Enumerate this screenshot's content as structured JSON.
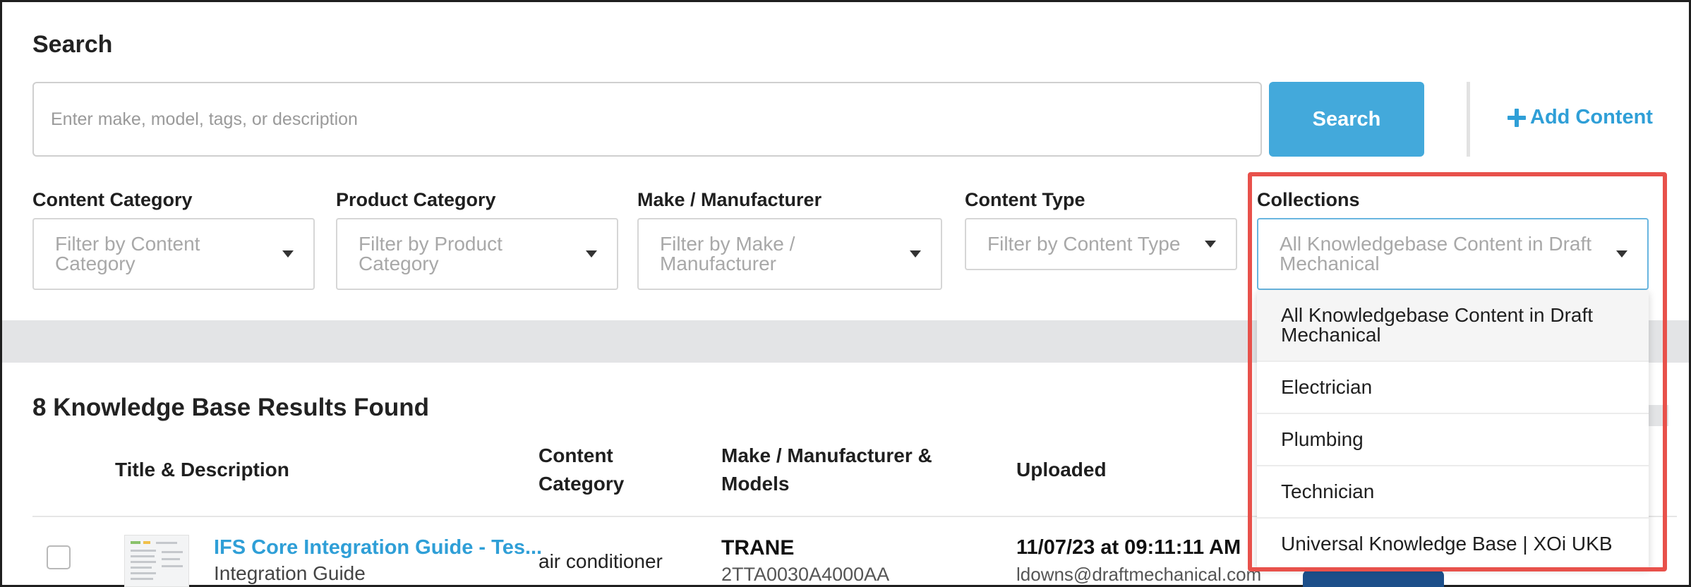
{
  "search": {
    "title": "Search",
    "placeholder": "Enter make, model, tags, or description",
    "button_label": "Search",
    "add_content_label": "Add Content"
  },
  "filters": [
    {
      "label": "Content Category",
      "placeholder": "Filter by Content Category",
      "line1": "Filter by Content",
      "line2": "Category"
    },
    {
      "label": "Product Category",
      "placeholder": "Filter by Product Category",
      "line1": "Filter by Product",
      "line2": "Category"
    },
    {
      "label": "Make / Manufacturer",
      "placeholder": "Filter by Make / Manufacturer",
      "line1": "Filter by Make /",
      "line2": "Manufacturer"
    },
    {
      "label": "Content Type",
      "placeholder": "Filter by Content Type",
      "line1": "Filter by Content Type",
      "line2": ""
    }
  ],
  "collections": {
    "label": "Collections",
    "selected_line1": "All Knowledgebase Content in Draft",
    "selected_line2": "Mechanical",
    "options": [
      {
        "line1": "All Knowledgebase Content in Draft",
        "line2": "Mechanical"
      },
      {
        "line1": "Electrician",
        "line2": ""
      },
      {
        "line1": "Plumbing",
        "line2": ""
      },
      {
        "line1": "Technician",
        "line2": ""
      },
      {
        "line1": "Universal Knowledge Base | XOi UKB",
        "line2": ""
      }
    ]
  },
  "results": {
    "count_title": "8 Knowledge Base Results Found",
    "columns": {
      "title": "Title & Description",
      "category_line1": "Content",
      "category_line2": "Category",
      "make_line1": "Make / Manufacturer &",
      "make_line2": "Models",
      "uploaded": "Uploaded"
    },
    "rows": [
      {
        "title": "IFS Core Integration Guide - Tes...",
        "description": "Integration Guide",
        "category": "air conditioner",
        "make": "TRANE",
        "model": "2TTA0030A4000AA",
        "uploaded": "11/07/23 at 09:11:11 AM",
        "uploader": "ldowns@draftmechanical.com"
      }
    ]
  },
  "colors": {
    "accent": "#43a9db",
    "link": "#2f9fd7",
    "highlight_box": "#e8514b"
  }
}
